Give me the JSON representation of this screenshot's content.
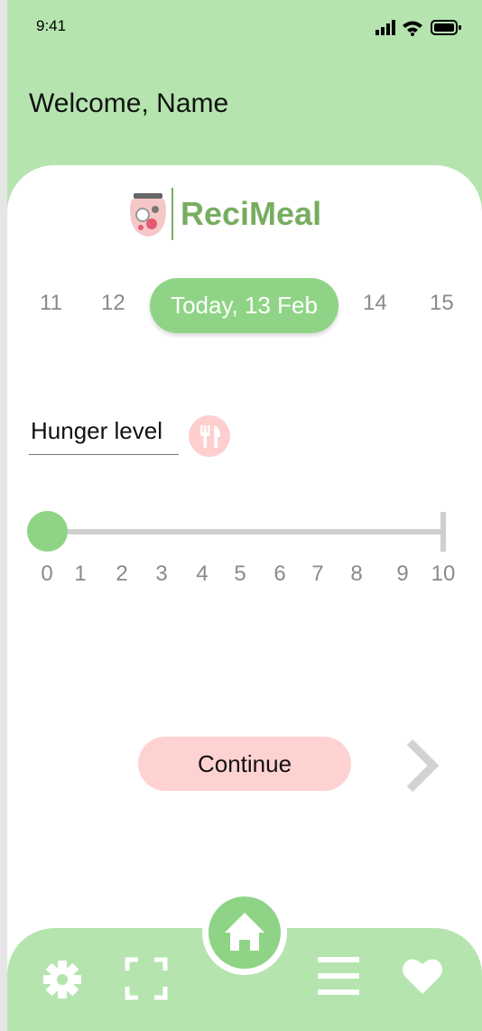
{
  "status_bar": {
    "time": "9:41"
  },
  "header": {
    "welcome": "Welcome, Name"
  },
  "brand": {
    "name": "ReciMeal",
    "color": "#77ad60"
  },
  "dates": {
    "items": [
      "11",
      "12",
      "14",
      "15"
    ],
    "selected": "Today, 13 Feb"
  },
  "hunger": {
    "label": "Hunger level",
    "value": 0,
    "min": 0,
    "max": 10,
    "ticks": [
      "0",
      "1",
      "2",
      "3",
      "4",
      "5",
      "6",
      "7",
      "8",
      "9",
      "10"
    ]
  },
  "actions": {
    "continue_label": "Continue"
  },
  "nav": {
    "items": [
      "settings-icon",
      "scan-icon",
      "home-icon",
      "menu-icon",
      "heart-icon"
    ]
  },
  "colors": {
    "background_green": "#b5e4af",
    "accent_green": "#8fd486",
    "accent_pink": "#ffd2d2"
  }
}
